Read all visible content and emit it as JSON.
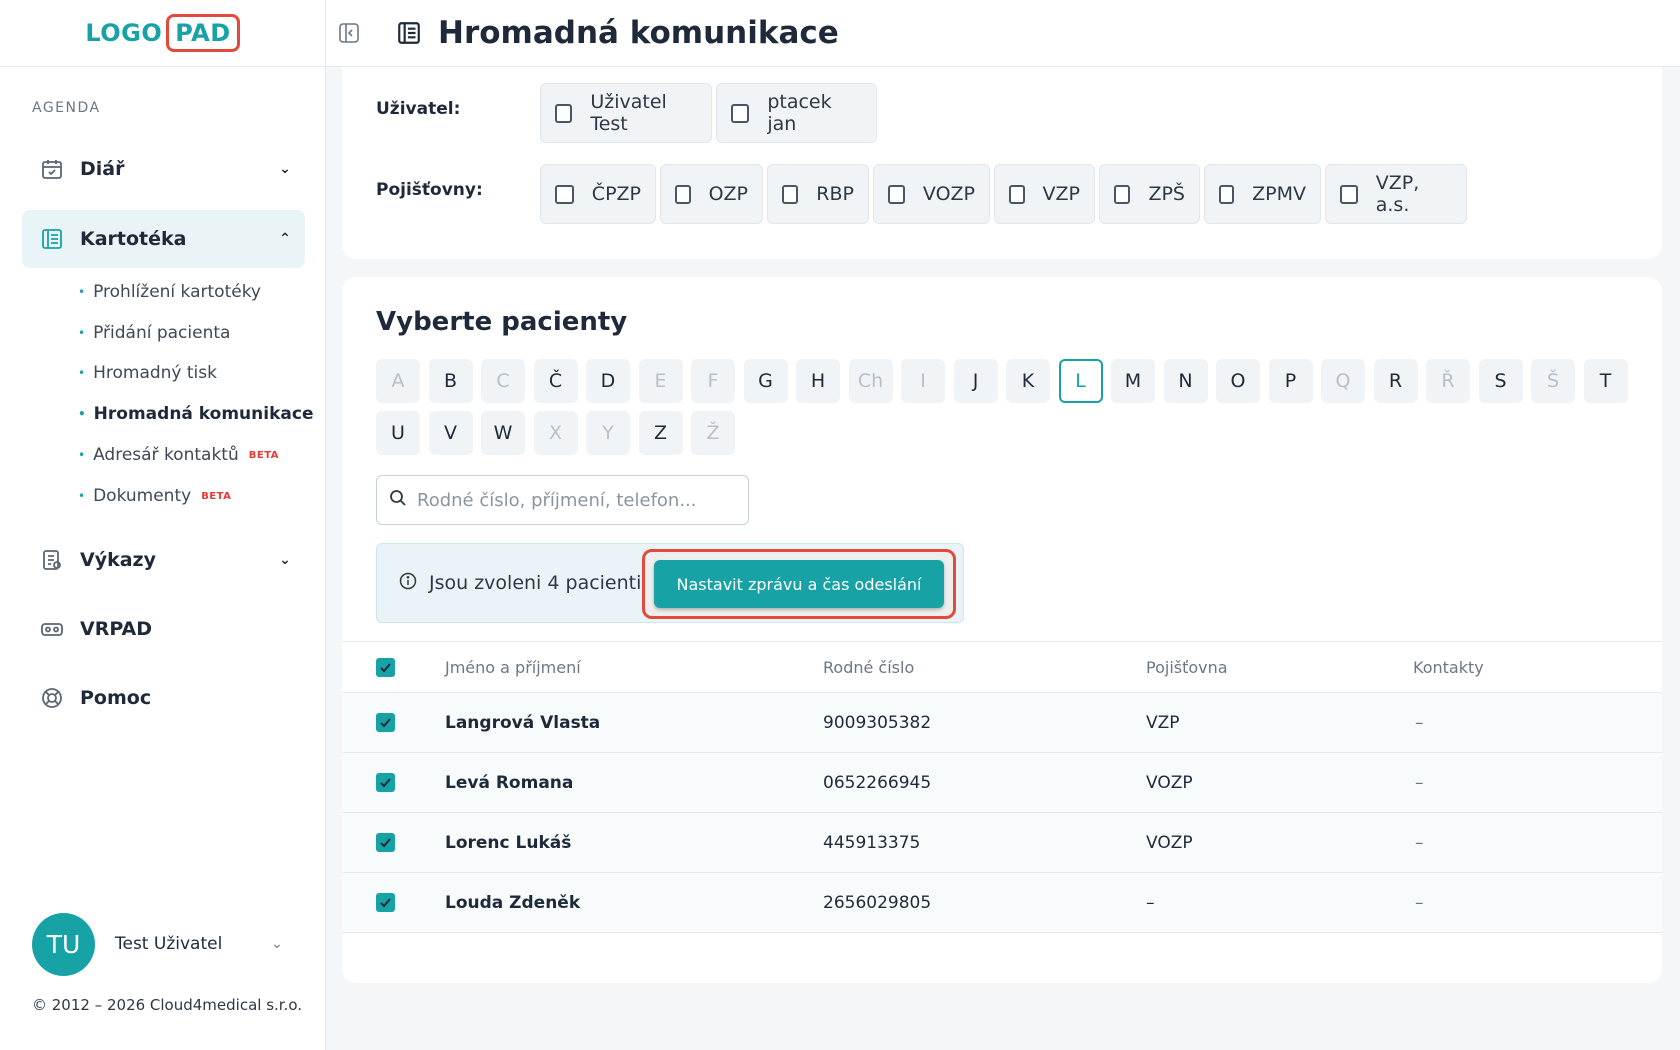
{
  "logo": {
    "left": "LOGO",
    "right": "PAD"
  },
  "sidebar": {
    "section_label": "AGENDA",
    "items": [
      {
        "label": "Diář",
        "icon": "calendar-icon"
      },
      {
        "label": "Kartotéka",
        "icon": "card-index-icon"
      },
      {
        "label": "Výkazy",
        "icon": "report-icon"
      },
      {
        "label": "VRPAD",
        "icon": "vr-headset-icon"
      },
      {
        "label": "Pomoc",
        "icon": "lifebuoy-icon"
      }
    ],
    "sub_items": [
      {
        "label": "Prohlížení kartotéky"
      },
      {
        "label": "Přidání pacienta"
      },
      {
        "label": "Hromadný tisk"
      },
      {
        "label": "Hromadná komunikace"
      },
      {
        "label": "Adresář kontaktů",
        "badge": "BETA"
      },
      {
        "label": "Dokumenty",
        "badge": "BETA"
      }
    ],
    "user": {
      "initials": "TU",
      "name": "Test Uživatel"
    },
    "copyright": "© 2012 – 2026 Cloud4medical s.r.o."
  },
  "header": {
    "title": "Hromadná komunikace"
  },
  "filters": {
    "user_label": "Uživatel:",
    "users": [
      "Uživatel Test",
      "ptacek jan"
    ],
    "insurers_label": "Pojišťovny:",
    "insurers": [
      "ČPZP",
      "OZP",
      "RBP",
      "VOZP",
      "VZP",
      "ZPŠ",
      "ZPMV",
      "VZP, a.s."
    ]
  },
  "patients": {
    "title": "Vyberte pacienty",
    "letters": [
      "A",
      "B",
      "C",
      "Č",
      "D",
      "E",
      "F",
      "G",
      "H",
      "Ch",
      "I",
      "J",
      "K",
      "L",
      "M",
      "N",
      "O",
      "P",
      "Q",
      "R",
      "Ř",
      "S",
      "Š",
      "T",
      "U",
      "V",
      "W",
      "X",
      "Y",
      "Z",
      "Ž"
    ],
    "disabled_letters": [
      "A",
      "C",
      "E",
      "F",
      "Ch",
      "I",
      "Q",
      "Ř",
      "Š",
      "X",
      "Y",
      "Ž"
    ],
    "selected_letter": "L",
    "search_placeholder": "Rodné číslo, příjmení, telefon...",
    "info_text": "Jsou zvoleni 4 pacienti",
    "action_button": "Nastavit zprávu a čas odeslání",
    "columns": [
      "Jméno a příjmení",
      "Rodné číslo",
      "Pojišťovna",
      "Kontakty"
    ],
    "rows": [
      {
        "name": "Langrová Vlasta",
        "id": "9009305382",
        "insurer": "VZP",
        "contacts": "–"
      },
      {
        "name": "Levá Romana",
        "id": "0652266945",
        "insurer": "VOZP",
        "contacts": "–"
      },
      {
        "name": "Lorenc Lukáš",
        "id": "445913375",
        "insurer": "VOZP",
        "contacts": "–"
      },
      {
        "name": "Louda Zdeněk",
        "id": "2656029805",
        "insurer": "–",
        "contacts": "–"
      }
    ]
  },
  "colors": {
    "accent": "#17a2a6",
    "highlight": "#e24a3b"
  }
}
